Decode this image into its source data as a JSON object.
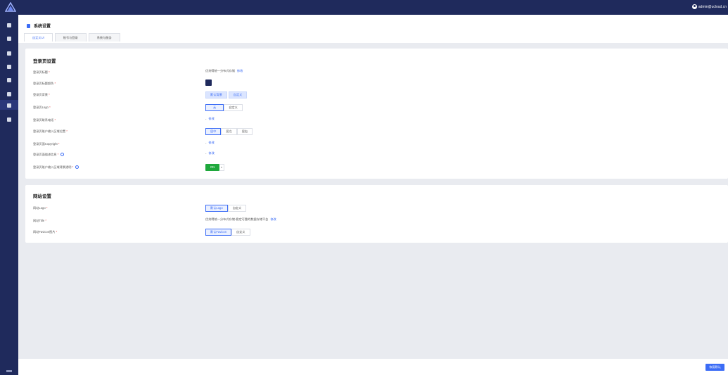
{
  "topbar": {
    "user_email": "admin@ucloud.cn",
    "logo_icon": "triangle-logo-icon"
  },
  "sidebar": {
    "icons": [
      "dashboard-icon",
      "user-icon",
      "storage-icon",
      "folder-icon",
      "document-icon",
      "settings-icon",
      "list-icon",
      "report-icon"
    ],
    "active_index": 5
  },
  "header": {
    "title": "系统设置",
    "tabs": [
      "自定义UI",
      "账号与登录",
      "系统与服务"
    ],
    "active_tab": 0
  },
  "login_section": {
    "title": "登录页设置",
    "rows": [
      {
        "label": "登录页标题",
        "value": "优刻得统一分布式存储",
        "link": "修改"
      },
      {
        "label": "登录页标题颜色",
        "color": "#1f2a5c"
      },
      {
        "label": "登录页背景",
        "options": [
          "默认背景",
          "自定义"
        ]
      },
      {
        "label": "登录页Logo",
        "options": [
          "无",
          "自定义"
        ]
      },
      {
        "label": "登录页联系电话",
        "value": "-",
        "link": "修改"
      },
      {
        "label": "登录页账户输入区域位置",
        "options": [
          "居中",
          "居左",
          "居右"
        ]
      },
      {
        "label": "登录页面Copyright",
        "value": "-",
        "link": "修改"
      },
      {
        "label": "登录页面描述信息",
        "value": "-",
        "link": "修改"
      },
      {
        "label": "登录页账户输入区域背景透明",
        "toggle": "ON"
      }
    ]
  },
  "site_section": {
    "title": "网站设置",
    "rows": [
      {
        "label": "网站Logo",
        "options": [
          "默认Logo",
          "自定义"
        ]
      },
      {
        "label": "网站Title",
        "value": "优刻得统一分布式存储-稳定可靠的数据存储平台",
        "link": "修改"
      },
      {
        "label": "网站Favicon图片",
        "options": [
          "默认Favicon",
          "自定义"
        ]
      }
    ]
  },
  "footer": {
    "reset_label": "恢复默认"
  },
  "required_mark": "*"
}
